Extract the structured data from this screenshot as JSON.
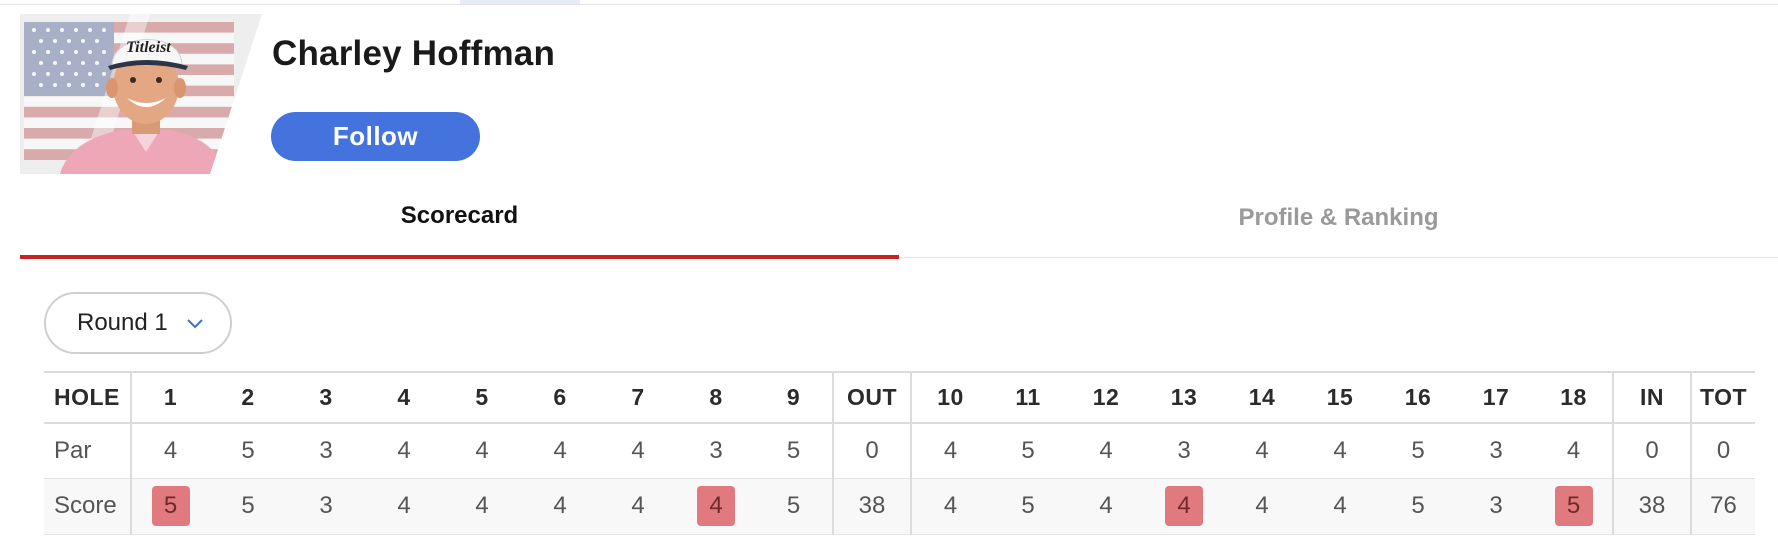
{
  "player": {
    "name": "Charley Hoffman",
    "cap_logo": "Titleist",
    "follow_label": "Follow"
  },
  "tabs": [
    {
      "label": "Scorecard",
      "active": true
    },
    {
      "label": "Profile & Ranking",
      "active": false
    }
  ],
  "round_select": {
    "value": "Round 1",
    "icon": "chevron-down-icon"
  },
  "scorecard": {
    "header": [
      "HOLE",
      "1",
      "2",
      "3",
      "4",
      "5",
      "6",
      "7",
      "8",
      "9",
      "OUT",
      "10",
      "11",
      "12",
      "13",
      "14",
      "15",
      "16",
      "17",
      "18",
      "IN",
      "TOT"
    ],
    "par": [
      "Par",
      "4",
      "5",
      "3",
      "4",
      "4",
      "4",
      "4",
      "3",
      "5",
      "0",
      "4",
      "5",
      "4",
      "3",
      "4",
      "4",
      "5",
      "3",
      "4",
      "0",
      "0"
    ],
    "score": [
      "Score",
      "5",
      "5",
      "3",
      "4",
      "4",
      "4",
      "4",
      "4",
      "5",
      "38",
      "4",
      "5",
      "4",
      "4",
      "4",
      "4",
      "5",
      "3",
      "5",
      "38",
      "76"
    ],
    "highlighted_holes": [
      "1",
      "8",
      "13",
      "18"
    ],
    "highlight_color": "#e07a7f"
  },
  "colors": {
    "accent_blue": "#4573dd",
    "tab_active_underline": "#c8231f",
    "tab_inactive_text": "#9a9a9a"
  }
}
